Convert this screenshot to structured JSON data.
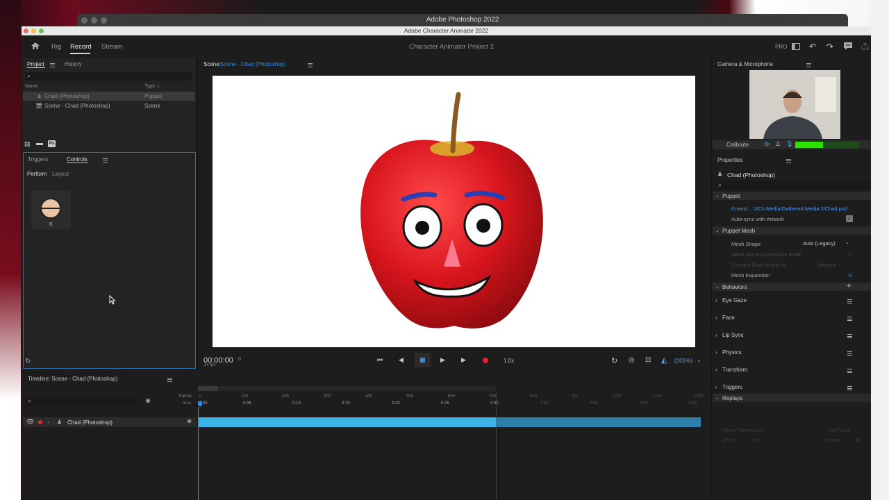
{
  "photoshop": {
    "title": "Adobe Photoshop 2022"
  },
  "window": {
    "title": "Adobe Character Animator 2022"
  },
  "topbar": {
    "tabs": [
      {
        "label": "Rig"
      },
      {
        "label": "Record"
      },
      {
        "label": "Stream"
      }
    ],
    "project_name": "Character Animator Project 2",
    "pro_label": "PRO"
  },
  "project_panel": {
    "tabs": [
      {
        "label": "Project"
      },
      {
        "label": "History"
      }
    ],
    "columns": {
      "name": "Name",
      "type": "Type"
    },
    "rows": [
      {
        "name": "Chad (Photoshop)",
        "type": "Puppet"
      },
      {
        "name": "Scene - Chad (Photoshop)",
        "type": "Scene"
      }
    ]
  },
  "controls_panel": {
    "tabs": [
      {
        "label": "Triggers"
      },
      {
        "label": "Controls"
      }
    ],
    "subtabs": [
      {
        "label": "Perform"
      },
      {
        "label": "Layout"
      }
    ],
    "control": {
      "key": "B"
    }
  },
  "scene": {
    "label": "Scene:",
    "name": "Scene - Chad (Photoshop)",
    "timecode": "00:00:00",
    "frame": "0",
    "fps": "24 fps",
    "speed": "1.0x",
    "zoom": "(101%)"
  },
  "camera_panel": {
    "title": "Camera & Microphone",
    "calibrate": "Calibrate"
  },
  "properties": {
    "title": "Properties",
    "puppet_name": "Chad (Photoshop)",
    "puppet_section": "Puppet",
    "path": "/Users/... 2/Ch Media/Gathered Media 2/Chad.psd",
    "auto_sync": "Auto-sync with Artwork",
    "mesh_section": "Puppet Mesh",
    "mesh_shape_label": "Mesh Shape",
    "mesh_shape_value": "Auto (Legacy)",
    "island_width_label": "Mesh Island Connection Width",
    "island_width_value": "0",
    "connect_label": "Connect Each Island to",
    "connect_value": "Nearest",
    "expansion_label": "Mesh Expansion",
    "expansion_value": "0",
    "behaviors_section": "Behaviors",
    "behaviors": [
      {
        "label": "Eye Gaze"
      },
      {
        "label": "Face"
      },
      {
        "label": "Lip Sync"
      },
      {
        "label": "Physics"
      },
      {
        "label": "Transform"
      },
      {
        "label": "Triggers"
      }
    ],
    "replays_section": "Replays",
    "trigger_ends_label": "When Trigger Ends",
    "trigger_ends_value": "Cut Finish",
    "offset_label": "Offset:",
    "offset_value": "- sec",
    "volume_label": "Volume:",
    "volume_value": "- dB"
  },
  "timeline": {
    "title": "Timeline: Scene - Chad (Photoshop)",
    "frames_label": "frames",
    "mss_label": "m:ss",
    "frame_ticks": [
      "0",
      "100",
      "200",
      "300",
      "400",
      "500",
      "600",
      "700",
      "800",
      "900",
      "1000",
      "1100",
      "1200"
    ],
    "time_ticks": [
      "0:00",
      "0:05",
      "0:10",
      "0:15",
      "0:20",
      "0:25",
      "0:30",
      "0:35",
      "0:40",
      "0:45",
      "0:50"
    ],
    "track": {
      "name": "Chad (Photoshop)"
    }
  },
  "colors": {
    "accent_blue": "#2d8ceb",
    "track_blue": "#3ab4e8",
    "record_red": "#e5242a",
    "apple_red": "#d8151d",
    "mic_green": "#2fe000"
  }
}
